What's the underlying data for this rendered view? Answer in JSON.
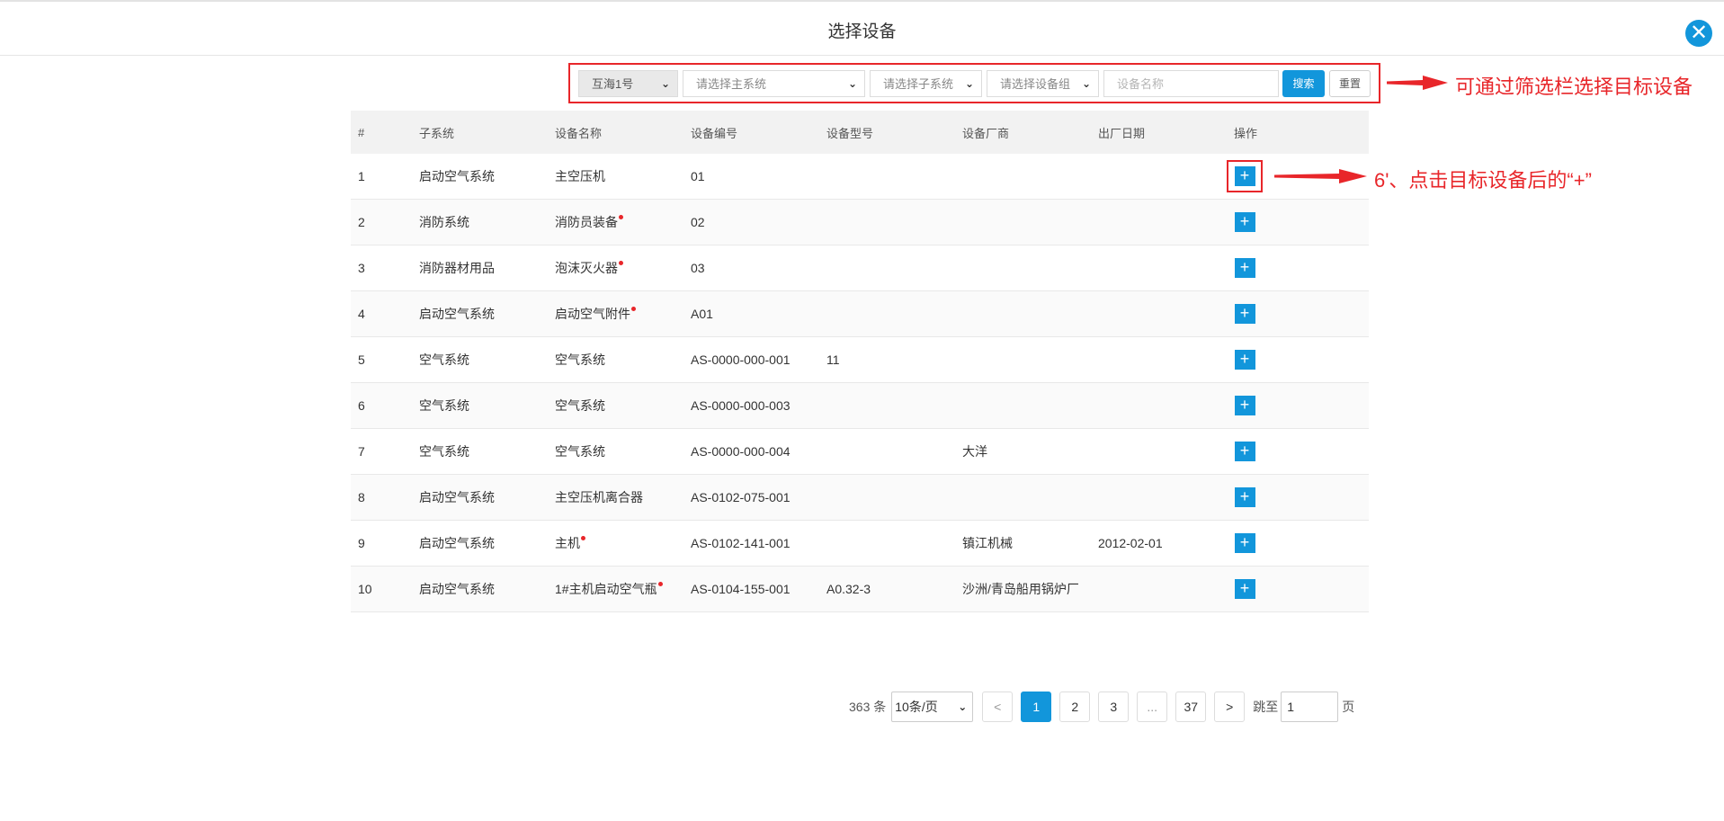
{
  "dialog": {
    "title": "选择设备",
    "close_symbol": "✕",
    "accent": "#1296db"
  },
  "filters": {
    "ship": "互海1号",
    "main_system_placeholder": "请选择主系统",
    "sub_system_placeholder": "请选择子系统",
    "device_group_placeholder": "请选择设备组",
    "device_name_placeholder": "设备名称",
    "search_label": "搜索",
    "reset_label": "重置"
  },
  "annotations": {
    "filter_note": "可通过筛选栏选择目标设备",
    "add_note": "6'、点击目标设备后的“+”",
    "color": "#e8262a"
  },
  "table": {
    "headers": [
      "#",
      "子系统",
      "设备名称",
      "设备编号",
      "设备型号",
      "设备厂商",
      "出厂日期",
      "操作"
    ],
    "rows": [
      {
        "no": "1",
        "subsystem": "启动空气系统",
        "name": "主空压机",
        "required": false,
        "code": "01",
        "model": "",
        "vendor": "",
        "date": ""
      },
      {
        "no": "2",
        "subsystem": "消防系统",
        "name": "消防员装备",
        "required": true,
        "code": "02",
        "model": "",
        "vendor": "",
        "date": ""
      },
      {
        "no": "3",
        "subsystem": "消防器材用品",
        "name": "泡沫灭火器",
        "required": true,
        "code": "03",
        "model": "",
        "vendor": "",
        "date": ""
      },
      {
        "no": "4",
        "subsystem": "启动空气系统",
        "name": "启动空气附件",
        "required": true,
        "code": "A01",
        "model": "",
        "vendor": "",
        "date": ""
      },
      {
        "no": "5",
        "subsystem": "空气系统",
        "name": "空气系统",
        "required": false,
        "code": "AS-0000-000-001",
        "model": "11",
        "vendor": "",
        "date": ""
      },
      {
        "no": "6",
        "subsystem": "空气系统",
        "name": "空气系统",
        "required": false,
        "code": "AS-0000-000-003",
        "model": "",
        "vendor": "",
        "date": ""
      },
      {
        "no": "7",
        "subsystem": "空气系统",
        "name": "空气系统",
        "required": false,
        "code": "AS-0000-000-004",
        "model": "",
        "vendor": "大洋",
        "date": ""
      },
      {
        "no": "8",
        "subsystem": "启动空气系统",
        "name": "主空压机离合器",
        "required": false,
        "code": "AS-0102-075-001",
        "model": "",
        "vendor": "",
        "date": ""
      },
      {
        "no": "9",
        "subsystem": "启动空气系统",
        "name": "主机",
        "required": true,
        "code": "AS-0102-141-001",
        "model": "",
        "vendor": "镇江机械",
        "date": "2012-02-01"
      },
      {
        "no": "10",
        "subsystem": "启动空气系统",
        "name": "1#主机启动空气瓶",
        "required": true,
        "code": "AS-0104-155-001",
        "model": "A0.32-3",
        "vendor": "沙洲/青岛船用锅炉厂",
        "date": ""
      }
    ],
    "add_symbol": "+"
  },
  "pagination": {
    "total": "363 条",
    "page_size": "10条/页",
    "prev": "<",
    "pages": [
      "1",
      "2",
      "3"
    ],
    "ellipsis": "...",
    "last": "37",
    "next": ">",
    "jump_label": "跳至",
    "jump_value": "1",
    "page_unit": "页",
    "current": "1"
  }
}
